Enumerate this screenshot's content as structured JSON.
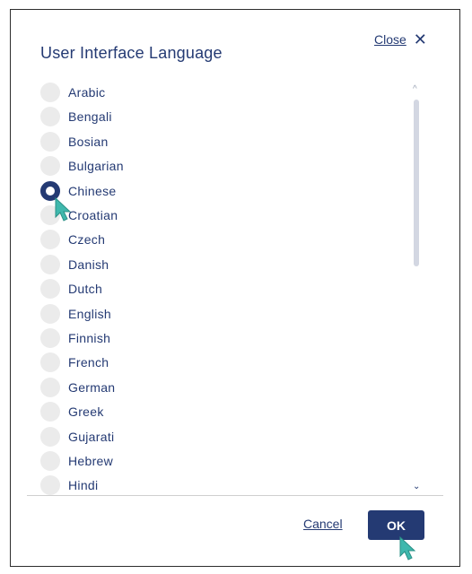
{
  "dialog": {
    "title": "User Interface Language",
    "close_label": "Close",
    "close_icon": "close-icon",
    "languages": [
      {
        "label": "Arabic",
        "selected": false
      },
      {
        "label": "Bengali",
        "selected": false
      },
      {
        "label": "Bosian",
        "selected": false
      },
      {
        "label": "Bulgarian",
        "selected": false
      },
      {
        "label": "Chinese",
        "selected": true
      },
      {
        "label": "Croatian",
        "selected": false
      },
      {
        "label": "Czech",
        "selected": false
      },
      {
        "label": "Danish",
        "selected": false
      },
      {
        "label": "Dutch",
        "selected": false
      },
      {
        "label": "English",
        "selected": false
      },
      {
        "label": "Finnish",
        "selected": false
      },
      {
        "label": "French",
        "selected": false
      },
      {
        "label": "German",
        "selected": false
      },
      {
        "label": "Greek",
        "selected": false
      },
      {
        "label": "Gujarati",
        "selected": false
      },
      {
        "label": "Hebrew",
        "selected": false
      },
      {
        "label": "Hindi",
        "selected": false
      }
    ],
    "cancel_label": "Cancel",
    "ok_label": "OK"
  },
  "colors": {
    "accent": "#243a73",
    "cursor": "#3fb8ad",
    "radio_unselected": "#ebebeb"
  }
}
